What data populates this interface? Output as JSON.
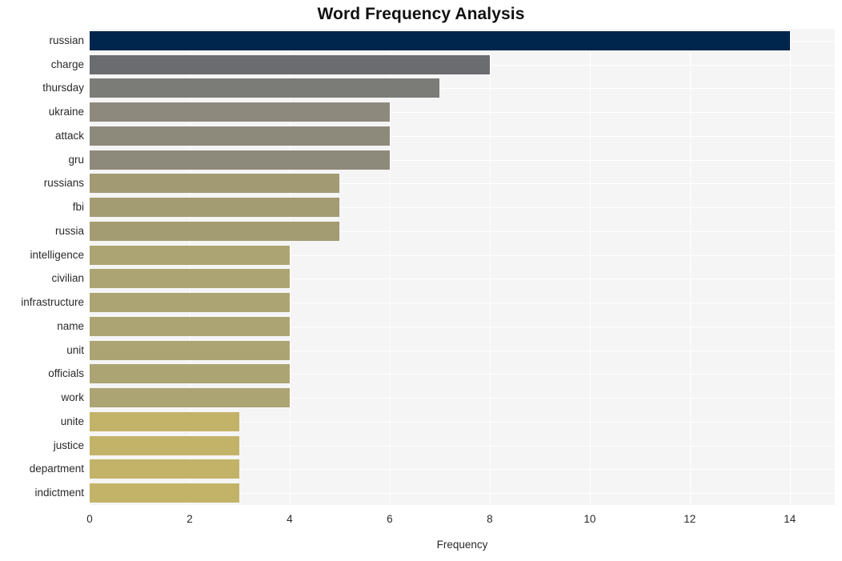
{
  "chart_data": {
    "type": "bar",
    "orientation": "horizontal",
    "title": "Word Frequency Analysis",
    "xlabel": "Frequency",
    "ylabel": "",
    "categories": [
      "russian",
      "charge",
      "thursday",
      "ukraine",
      "attack",
      "gru",
      "russians",
      "fbi",
      "russia",
      "intelligence",
      "civilian",
      "infrastructure",
      "name",
      "unit",
      "officials",
      "work",
      "unite",
      "justice",
      "department",
      "indictment"
    ],
    "values": [
      14,
      8,
      7,
      6,
      6,
      6,
      5,
      5,
      5,
      4,
      4,
      4,
      4,
      4,
      4,
      4,
      3,
      3,
      3,
      3
    ],
    "bar_colors": [
      "#00264d",
      "#6b6c70",
      "#7b7b78",
      "#8d897c",
      "#8d8a7c",
      "#8e8a7b",
      "#a29a72",
      "#a39b72",
      "#a39b72",
      "#aca473",
      "#aca473",
      "#aca473",
      "#aca473",
      "#aca473",
      "#aca473",
      "#aca473",
      "#c3b369",
      "#c3b369",
      "#c3b369",
      "#c3b369"
    ],
    "xlim": [
      0,
      14.9
    ],
    "xticks": [
      0,
      2,
      4,
      6,
      8,
      10,
      12,
      14
    ],
    "xtick_labels": [
      "0",
      "2",
      "4",
      "6",
      "8",
      "10",
      "12",
      "14"
    ],
    "grid": true,
    "grid_color": "#ffffff",
    "plot_background": "#f5f5f6",
    "figure_background": "#ffffff",
    "legend": null,
    "annotations": []
  }
}
